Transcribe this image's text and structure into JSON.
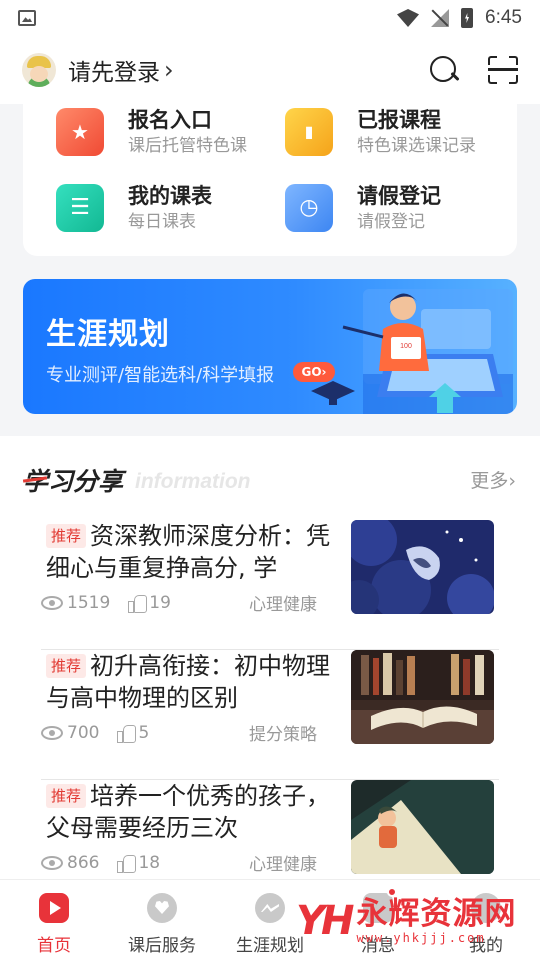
{
  "status_bar": {
    "time": "6:45"
  },
  "header": {
    "login_label": "请先登录",
    "chevron": "›"
  },
  "grid": [
    {
      "title": "报名入口",
      "subtitle": "课后托管特色课",
      "icon": "star-badge-icon",
      "color": "#f04a34"
    },
    {
      "title": "已报课程",
      "subtitle": "特色课选课记录",
      "icon": "bookmark-icon",
      "color": "#f5a31a"
    },
    {
      "title": "我的课表",
      "subtitle": "每日课表",
      "icon": "schedule-icon",
      "color": "#12b893"
    },
    {
      "title": "请假登记",
      "subtitle": "请假登记",
      "icon": "clock-icon",
      "color": "#3d86f2"
    }
  ],
  "banner": {
    "title": "生涯规划",
    "subtitle": "专业测评/智能选科/科学填报",
    "go_label": "GO",
    "go_chevron": "›",
    "illus_paper": "100"
  },
  "feed": {
    "title": "学习分享",
    "title_en": "information",
    "more_label": "更多",
    "more_chevron": "›",
    "articles": [
      {
        "tag": "推荐",
        "title": "资深教师深度分析：凭细心与重复挣高分, 学",
        "views": "1519",
        "likes": "19",
        "category": "心理健康"
      },
      {
        "tag": "推荐",
        "title": "初升高衔接：初中物理与高中物理的区别",
        "views": "700",
        "likes": "5",
        "category": "提分策略"
      },
      {
        "tag": "推荐",
        "title": "培养一个优秀的孩子，父母需要经历三次",
        "views": "866",
        "likes": "18",
        "category": "心理健康"
      }
    ]
  },
  "bottom_nav": [
    {
      "label": "首页",
      "icon": "home-play-icon",
      "active": true
    },
    {
      "label": "课后服务",
      "icon": "heart-service-icon",
      "active": false
    },
    {
      "label": "生涯规划",
      "icon": "career-icon",
      "active": false
    },
    {
      "label": "消息",
      "icon": "message-icon",
      "active": false
    },
    {
      "label": "我的",
      "icon": "profile-icon",
      "active": false
    }
  ],
  "watermark": {
    "logo": "YH",
    "name": "永辉资源网",
    "url": "www.yhkjjj.com"
  },
  "colors": {
    "accent": "#e8333a",
    "banner_blue": "#1a78ff"
  }
}
